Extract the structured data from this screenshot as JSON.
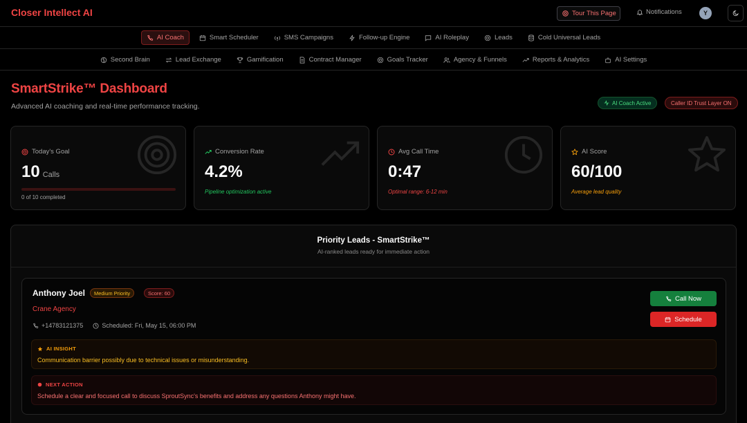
{
  "app": {
    "brand": "Closer Intellect AI"
  },
  "topbar": {
    "tour_label": "Tour This Page",
    "notifications_label": "Notifications",
    "avatar_initial": "Y"
  },
  "nav_primary": [
    {
      "label": "AI Coach",
      "icon": "phone-icon",
      "active": true
    },
    {
      "label": "Smart Scheduler",
      "icon": "calendar-icon",
      "active": false
    },
    {
      "label": "SMS Campaigns",
      "icon": "broadcast-icon",
      "active": false
    },
    {
      "label": "Follow-up Engine",
      "icon": "zap-icon",
      "active": false
    },
    {
      "label": "AI Roleplay",
      "icon": "chat-icon",
      "active": false
    },
    {
      "label": "Leads",
      "icon": "target-icon",
      "active": false
    },
    {
      "label": "Cold Universal Leads",
      "icon": "database-icon",
      "active": false
    }
  ],
  "nav_secondary": [
    {
      "label": "Second Brain",
      "icon": "brain-icon"
    },
    {
      "label": "Lead Exchange",
      "icon": "swap-icon"
    },
    {
      "label": "Gamification",
      "icon": "trophy-icon"
    },
    {
      "label": "Contract Manager",
      "icon": "file-icon"
    },
    {
      "label": "Goals Tracker",
      "icon": "target-icon"
    },
    {
      "label": "Agency & Funnels",
      "icon": "users-icon"
    },
    {
      "label": "Reports & Analytics",
      "icon": "trend-icon"
    },
    {
      "label": "AI Settings",
      "icon": "bot-icon"
    }
  ],
  "header": {
    "title": "SmartStrike™ Dashboard",
    "subtitle": "Advanced AI coaching and real-time performance tracking.",
    "badge_coach": "AI Coach Active",
    "badge_caller": "Caller ID Trust Layer ON"
  },
  "stats": {
    "goal": {
      "label": "Today's Goal",
      "value": "10",
      "unit": "Calls",
      "progress_text": "0 of 10 completed",
      "progress": 0
    },
    "conversion": {
      "label": "Conversion Rate",
      "value": "4.2%",
      "note": "Pipeline optimization active"
    },
    "call_time": {
      "label": "Avg Call Time",
      "value": "0:47",
      "note": "Optimal range: 6-12 min"
    },
    "ai_score": {
      "label": "AI Score",
      "value": "60/100",
      "note": "Average lead quality"
    }
  },
  "priority": {
    "title": "Priority Leads - SmartStrike™",
    "subtitle": "AI-ranked leads ready for immediate action",
    "lead": {
      "name": "Anthony Joel",
      "priority": "Medium Priority",
      "score": "Score: 60",
      "company": "Crane Agency",
      "phone": "+14783121375",
      "scheduled": "Scheduled: Fri, May 15, 06:00 PM",
      "call_label": "Call Now",
      "schedule_label": "Schedule",
      "insight_label": "AI INSIGHT",
      "insight_text": "Communication barrier possibly due to technical issues or misunderstanding.",
      "next_label": "NEXT ACTION",
      "next_text": "Schedule a clear and focused call to discuss SproutSync's benefits and address any questions Anthony might have."
    }
  },
  "colors": {
    "accent": "#ef4444",
    "success": "#22c55e",
    "warning": "#f59e0b",
    "background": "#000000"
  }
}
